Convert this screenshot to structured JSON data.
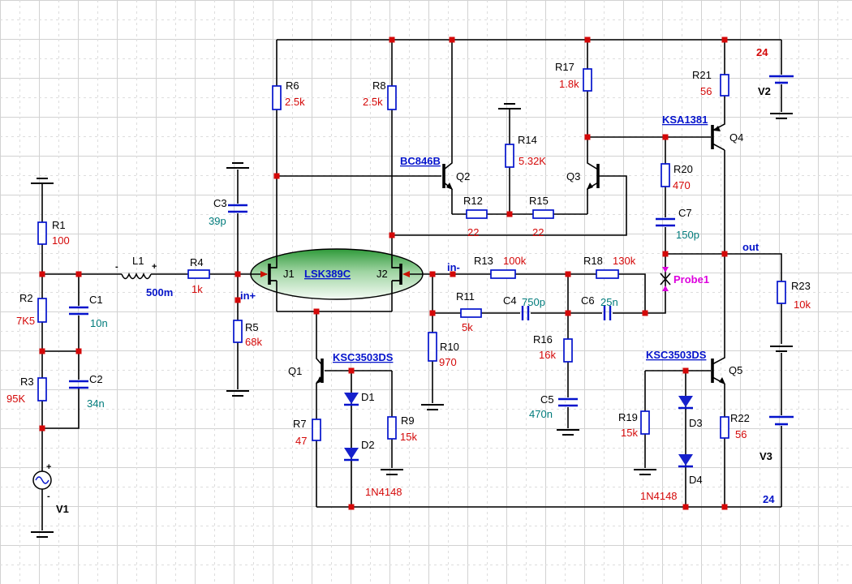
{
  "colors": {
    "wire": "#000000",
    "symbol_blue": "#0413cc",
    "junction_red": "#d40808",
    "resistor_value_red": "#d40808",
    "capacitor_value_teal": "#007b7b",
    "net_label_blue": "#0413c8",
    "probe_magenta": "#dd00dd",
    "jfet_fill_green": "#3f9f46"
  },
  "resistors": {
    "R1": {
      "label": "R1",
      "value": "100"
    },
    "R2": {
      "label": "R2",
      "value": "7K5"
    },
    "R3": {
      "label": "R3",
      "value": "95K"
    },
    "R4": {
      "label": "R4",
      "value": "1k"
    },
    "R5": {
      "label": "R5",
      "value": "68k"
    },
    "R6": {
      "label": "R6",
      "value": "2.5k"
    },
    "R7": {
      "label": "R7",
      "value": "47"
    },
    "R8": {
      "label": "R8",
      "value": "2.5k"
    },
    "R9": {
      "label": "R9",
      "value": "15k"
    },
    "R10": {
      "label": "R10",
      "value": "970"
    },
    "R11": {
      "label": "R11",
      "value": "5k"
    },
    "R12": {
      "label": "R12",
      "value": "22"
    },
    "R13": {
      "label": "R13",
      "value": "100k"
    },
    "R14": {
      "label": "R14",
      "value": "5.32K"
    },
    "R15": {
      "label": "R15",
      "value": "22"
    },
    "R16": {
      "label": "R16",
      "value": "16k"
    },
    "R17": {
      "label": "R17",
      "value": "1.8k"
    },
    "R18": {
      "label": "R18",
      "value": "130k"
    },
    "R19": {
      "label": "R19",
      "value": "15k"
    },
    "R20": {
      "label": "R20",
      "value": "470"
    },
    "R21": {
      "label": "R21",
      "value": "56"
    },
    "R22": {
      "label": "R22",
      "value": "56"
    },
    "R23": {
      "label": "R23",
      "value": "10k"
    }
  },
  "capacitors": {
    "C1": {
      "label": "C1",
      "value": "10n"
    },
    "C2": {
      "label": "C2",
      "value": "34n"
    },
    "C3": {
      "label": "C3",
      "value": "39p"
    },
    "C4": {
      "label": "C4",
      "value": "750p"
    },
    "C5": {
      "label": "C5",
      "value": "470n"
    },
    "C6": {
      "label": "C6",
      "value": "25n"
    },
    "C7": {
      "label": "C7",
      "value": "150p"
    }
  },
  "inductors": {
    "L1": {
      "label": "L1",
      "value": "500m"
    }
  },
  "diodes": {
    "D1": {
      "label": "D1"
    },
    "D2": {
      "label": "D2"
    },
    "D3": {
      "label": "D3"
    },
    "D4": {
      "label": "D4"
    },
    "model_left": "1N4148",
    "model_right": "1N4148"
  },
  "transistors": {
    "Q1": {
      "label": "Q1",
      "part": "KSC3503DS"
    },
    "Q2": {
      "label": "Q2",
      "part": "BC846B"
    },
    "Q3": {
      "label": "Q3"
    },
    "Q4": {
      "label": "Q4",
      "part": "KSA1381"
    },
    "Q5": {
      "label": "Q5",
      "part": "KSC3503DS"
    }
  },
  "jfets": {
    "part": "LSK389C",
    "J1": {
      "label": "J1"
    },
    "J2": {
      "label": "J2"
    }
  },
  "sources": {
    "V1": {
      "label": "V1"
    },
    "V2": {
      "label": "V2",
      "value": "24"
    },
    "V3": {
      "label": "V3",
      "value": "24"
    }
  },
  "net_labels": {
    "in_plus": "in+",
    "in_minus": "in-",
    "out": "out"
  },
  "probes": {
    "probe1": "Probe1"
  },
  "polarity": {
    "plus": "+",
    "minus": "-"
  }
}
